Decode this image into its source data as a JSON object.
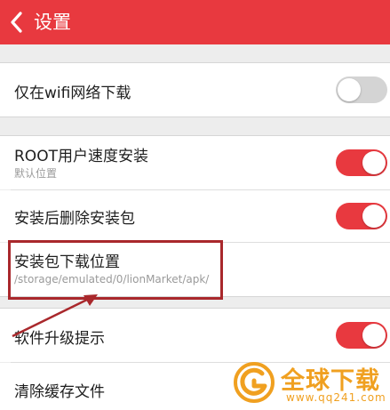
{
  "header": {
    "title": "设置",
    "back_icon": "chevron-left-icon"
  },
  "settings": {
    "wifi_only": {
      "label": "仅在wifi网络下载",
      "enabled": false
    },
    "root_install": {
      "label": "ROOT用户速度安装",
      "sublabel": "默认位置",
      "enabled": true
    },
    "delete_after_install": {
      "label": "安装后删除安装包",
      "enabled": true
    },
    "download_location": {
      "label": "安装包下载位置",
      "path": "/storage/emulated/0/lionMarket/apk/"
    },
    "upgrade_notice": {
      "label": "软件升级提示",
      "enabled": true
    },
    "clear_cache": {
      "label": "清除缓存文件"
    }
  },
  "watermark": {
    "title": "全球下载",
    "url": "www.qq241.com"
  },
  "colors": {
    "accent": "#e8393f",
    "toggle_off": "#d4d4d4",
    "annotation": "#a9282c",
    "watermark": "#f0a020"
  }
}
